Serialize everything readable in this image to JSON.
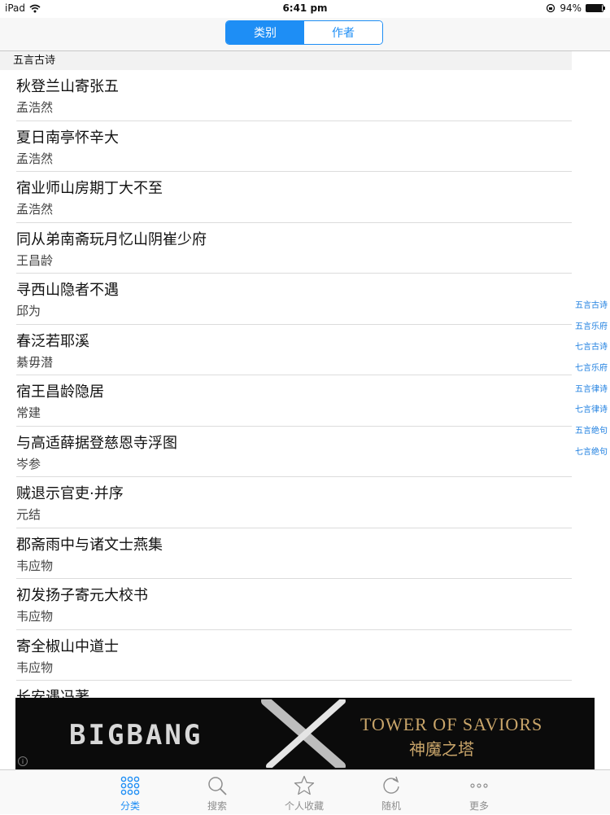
{
  "status_bar": {
    "device": "iPad",
    "time": "6:41 pm",
    "battery": "94%",
    "battery_level": 0.94
  },
  "segmented": {
    "items": [
      "类别",
      "作者"
    ],
    "selected": 0
  },
  "section_title": "五言古诗",
  "poems": [
    {
      "title": "秋登兰山寄张五",
      "author": "孟浩然"
    },
    {
      "title": "夏日南亭怀辛大",
      "author": "孟浩然"
    },
    {
      "title": "宿业师山房期丁大不至",
      "author": "孟浩然"
    },
    {
      "title": "同从弟南斋玩月忆山阴崔少府",
      "author": "王昌龄"
    },
    {
      "title": "寻西山隐者不遇",
      "author": "邱为"
    },
    {
      "title": "春泛若耶溪",
      "author": "綦毋潜"
    },
    {
      "title": "宿王昌龄隐居",
      "author": "常建"
    },
    {
      "title": "与高适薛据登慈恩寺浮图",
      "author": "岑参"
    },
    {
      "title": "贼退示官吏·并序",
      "author": "元结"
    },
    {
      "title": "郡斋雨中与诸文士燕集",
      "author": "韦应物"
    },
    {
      "title": "初发扬子寄元大校书",
      "author": "韦应物"
    },
    {
      "title": "寄全椒山中道士",
      "author": "韦应物"
    },
    {
      "title": "长安遇冯著",
      "author": ""
    }
  ],
  "index": [
    "五言古诗",
    "五言乐府",
    "七言古诗",
    "七言乐府",
    "五言律诗",
    "七言律诗",
    "五言绝句",
    "七言绝句"
  ],
  "ad": {
    "left_text": "BIGBANG",
    "right_title": "TOWER OF SAVIORS",
    "right_subtitle": "神魔之塔",
    "info": "i"
  },
  "tabs": [
    {
      "label": "分类",
      "icon": "grid-dots-icon",
      "active": true
    },
    {
      "label": "搜索",
      "icon": "search-icon",
      "active": false
    },
    {
      "label": "个人收藏",
      "icon": "star-icon",
      "active": false
    },
    {
      "label": "随机",
      "icon": "refresh-icon",
      "active": false
    },
    {
      "label": "更多",
      "icon": "more-dots-icon",
      "active": false
    }
  ],
  "colors": {
    "accent": "#1e8ef5",
    "index_text": "#1e7fe0",
    "ad_gold": "#c9a56a"
  }
}
